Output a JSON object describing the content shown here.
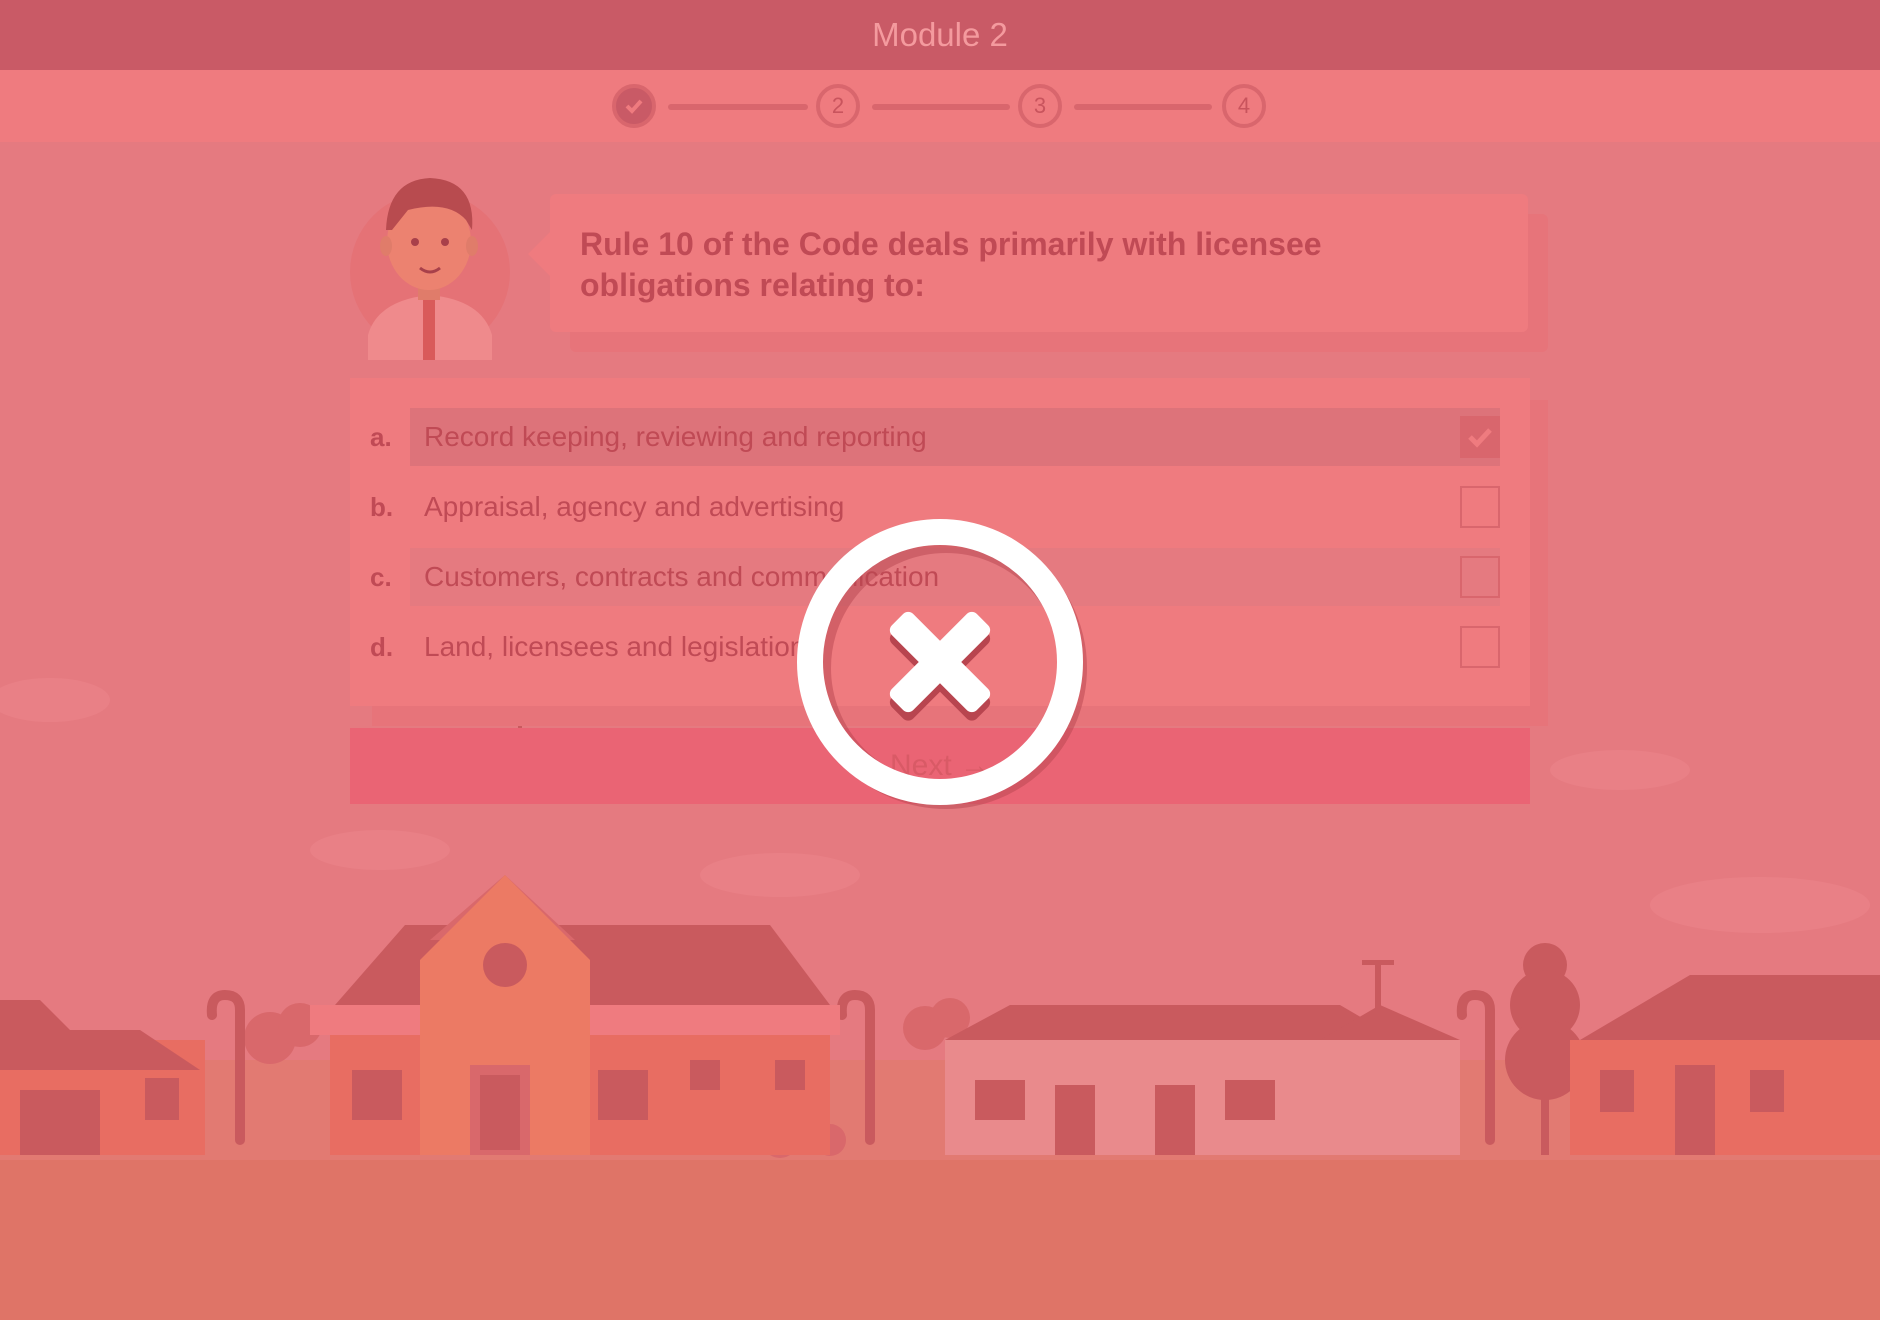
{
  "header": {
    "title": "Module 2"
  },
  "steps": [
    {
      "label": "",
      "state": "done",
      "icon": "check-icon"
    },
    {
      "label": "2",
      "state": "current"
    },
    {
      "label": "3",
      "state": "upcoming"
    },
    {
      "label": "4",
      "state": "upcoming"
    }
  ],
  "question": {
    "text": "Rule 10 of the Code deals primarily with licensee obligations relating to:"
  },
  "options": [
    {
      "letter": "a.",
      "text": "Record keeping, reviewing and reporting",
      "checked": true
    },
    {
      "letter": "b.",
      "text": "Appraisal, agency and advertising",
      "checked": false
    },
    {
      "letter": "c.",
      "text": "Customers, contracts and communication",
      "checked": false
    },
    {
      "letter": "d.",
      "text": "Land, licensees and legislation",
      "checked": false
    }
  ],
  "next_button": {
    "label": "Next →"
  },
  "feedback": {
    "result": "incorrect",
    "icon": "close-circle-icon"
  },
  "colors": {
    "header": "#c95a66",
    "overlay": "#e57a80",
    "feedback_icon": "#ffffff"
  }
}
